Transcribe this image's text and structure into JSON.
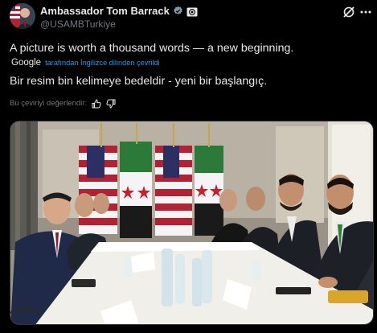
{
  "author": {
    "display_name": "Ambassador Tom Barrack",
    "handle": "@USAMBTurkiye",
    "verified_icon": "verified-badge-icon",
    "affiliate_icon": "government-badge-icon"
  },
  "post": {
    "text": "A picture is worth a thousand words — a new beginning.",
    "translation_provider": "Google",
    "translation_label": "tarafından İngilizce dilinden çevrildi",
    "translated_text": "Bir resim bin kelimeye bedeldir - yeni bir başlangıç.",
    "rate_label": "Bu çeviriyi değerlendir:"
  },
  "colors": {
    "background": "#000000",
    "text": "#e7e9ea",
    "secondary": "#71767b",
    "link": "#1d9bf0"
  }
}
